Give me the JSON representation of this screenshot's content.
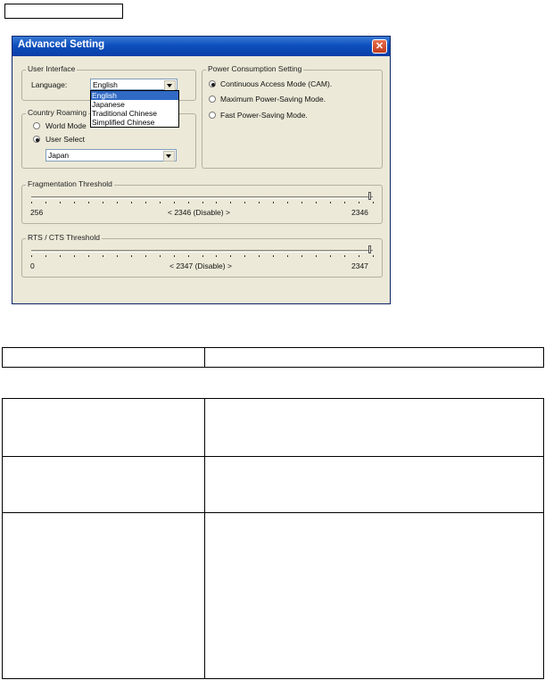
{
  "dialog": {
    "title": "Advanced Setting",
    "close_glyph": "✕"
  },
  "user_interface": {
    "group_label": "User Interface",
    "language_label": "Language:",
    "language_value": "English",
    "language_options": [
      "English",
      "Japanese",
      "Traditional Chinese",
      "Simplified Chinese"
    ]
  },
  "country_roaming": {
    "group_label": "Country Roaming",
    "world_mode_label": "World Mode",
    "user_select_label": "User Select",
    "country_value": "Japan",
    "selected": "User Select"
  },
  "power": {
    "group_label": "Power Consumption Setting",
    "options": [
      "Continuous Access Mode (CAM).",
      "Maximum Power-Saving Mode.",
      "Fast Power-Saving Mode."
    ],
    "selected": "Continuous Access Mode (CAM)."
  },
  "fragmentation": {
    "group_label": "Fragmentation Threshold",
    "min_label": "256",
    "center_label": "< 2346 (Disable) >",
    "max_label": "2346",
    "value": 2346
  },
  "rts_cts": {
    "group_label": "RTS / CTS Threshold",
    "min_label": "0",
    "center_label": "< 2347 (Disable) >",
    "max_label": "2347",
    "value": 2347
  },
  "colors": {
    "titlebar": "#0d4fbd",
    "dialog_bg": "#ece9d8",
    "selection": "#316ac5"
  },
  "icons": {
    "close": "close-icon",
    "dropdown": "chevron-down-icon"
  }
}
